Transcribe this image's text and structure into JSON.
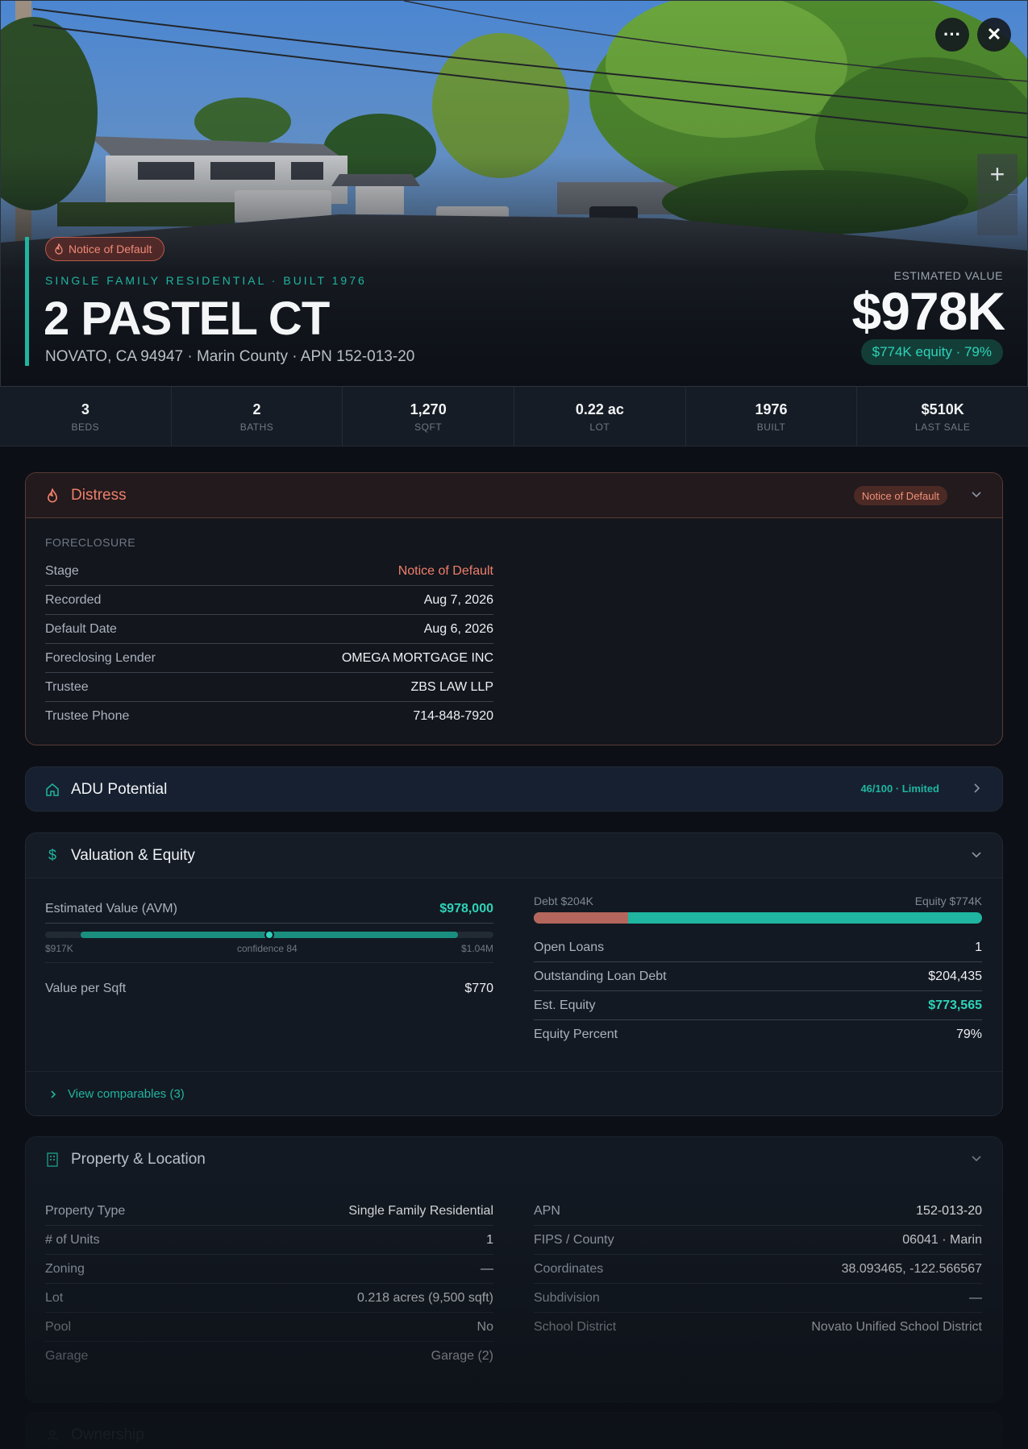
{
  "hero": {
    "status_badge": "Notice of Default",
    "subtitle": "SINGLE FAMILY RESIDENTIAL · BUILT 1976",
    "address": "2 PASTEL CT",
    "location": "NOVATO, CA 94947 · Marin County · APN 152-013-20",
    "est_label": "ESTIMATED VALUE",
    "est_value": "$978K",
    "equity_pill": "$774K equity · 79%",
    "more_icon": "···",
    "close_icon": "✕",
    "zoom_in_icon": "+"
  },
  "stats": [
    {
      "value": "3",
      "label": "BEDS"
    },
    {
      "value": "2",
      "label": "BATHS"
    },
    {
      "value": "1,270",
      "label": "SQFT"
    },
    {
      "value": "0.22 ac",
      "label": "LOT"
    },
    {
      "value": "1976",
      "label": "BUILT"
    },
    {
      "value": "$510K",
      "label": "LAST SALE"
    }
  ],
  "distress": {
    "title": "Distress",
    "badge": "Notice of Default",
    "section_label": "FORECLOSURE",
    "rows": [
      {
        "k": "Stage",
        "v": "Notice of Default"
      },
      {
        "k": "Recorded",
        "v": "Aug 7, 2026"
      },
      {
        "k": "Default Date",
        "v": "Aug 6, 2026"
      },
      {
        "k": "Foreclosing Lender",
        "v": "OMEGA MORTGAGE INC"
      },
      {
        "k": "Trustee",
        "v": "ZBS LAW LLP"
      },
      {
        "k": "Trustee Phone",
        "v": "714-848-7920"
      }
    ],
    "accent": "#ef7f6a"
  },
  "adu": {
    "title": "ADU Potential",
    "score": "46/100 · Limited"
  },
  "valuation": {
    "title": "Valuation & Equity",
    "avm_label": "Estimated Value (AVM)",
    "avm_value": "$978,000",
    "range_low": "$917K",
    "range_high": "$1.04M",
    "confidence": "confidence 84",
    "avm_position": 0.5,
    "per_sqft_label": "Value per Sqft",
    "per_sqft_value": "$770",
    "debt_label": "Debt $204K",
    "equity_label": "Equity $774K",
    "debt_fraction": 0.21,
    "rows": [
      {
        "k": "Open Loans",
        "v": "1"
      },
      {
        "k": "Outstanding Loan Debt",
        "v": "$204,435"
      },
      {
        "k": "Est. Equity",
        "v": "$773,565"
      },
      {
        "k": "Equity Percent",
        "v": "79%"
      }
    ],
    "comps_link": "View comparables (3)"
  },
  "property": {
    "title": "Property & Location",
    "left": [
      {
        "k": "Property Type",
        "v": "Single Family Residential"
      },
      {
        "k": "# of Units",
        "v": "1"
      },
      {
        "k": "Zoning",
        "v": "—"
      },
      {
        "k": "Lot",
        "v": "0.218 acres (9,500 sqft)"
      },
      {
        "k": "Pool",
        "v": "No"
      },
      {
        "k": "Garage",
        "v": "Garage (2)"
      }
    ],
    "right": [
      {
        "k": "APN",
        "v": "152-013-20"
      },
      {
        "k": "FIPS / County",
        "v": "06041 · Marin"
      },
      {
        "k": "Coordinates",
        "v": "38.093465, -122.566567"
      },
      {
        "k": "Subdivision",
        "v": "—"
      },
      {
        "k": "School District",
        "v": "Novato Unified School District"
      }
    ]
  },
  "ownership": {
    "title": "Ownership"
  },
  "colors": {
    "accent_teal": "#1fb5a0",
    "distress_red": "#ef7f6a",
    "background": "#0c1016"
  }
}
